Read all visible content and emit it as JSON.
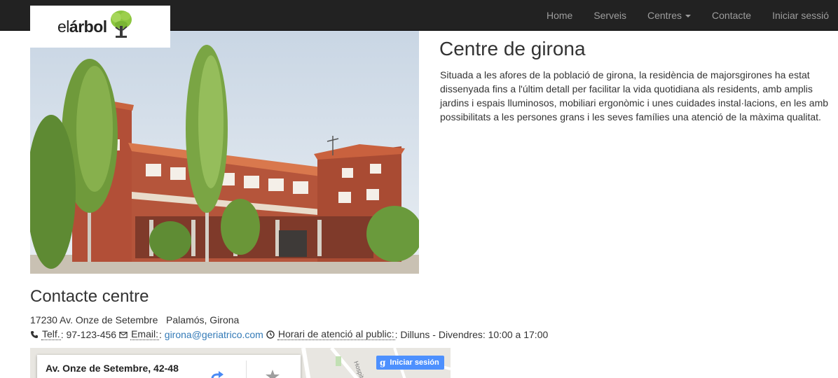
{
  "nav": {
    "items": [
      {
        "label": "Home"
      },
      {
        "label": "Serveis"
      },
      {
        "label": "Centres"
      },
      {
        "label": "Contacte"
      },
      {
        "label": "Iniciar sessió"
      }
    ]
  },
  "logo": {
    "text_light": "el",
    "text_bold": "árbol"
  },
  "centre": {
    "title": "Centre de girona",
    "description": "Situada a les afores de la població de girona, la residència de majorsgirones ha estat dissenyada fins a l'últim detall per facilitar la vida quotidiana als residents, amb amplis jardins i espais lluminosos, mobiliari ergonòmic i unes cuidades instal·lacions, en les amb possibilitats a les persones grans i les seves famílies una atenció de la màxima qualitat."
  },
  "contact": {
    "heading": "Contacte centre",
    "address": "17230 Av. Onze de Setembre   Palamós, Girona",
    "phone_label": "Telf.",
    "phone_sep": ":",
    "phone": "97-123-456",
    "email_label": "Email:",
    "email_sep": ":",
    "email": "girona@geriatrico.com",
    "hours_label": "Horari de atenció al public:",
    "hours_sep": ":",
    "hours": "Dilluns - Divendres: 10:00 a 17:00"
  },
  "map": {
    "place": "Av. Onze de Setembre, 42-48",
    "signin_label": "Iniciar sesión",
    "signin_g": "g"
  },
  "colors": {
    "navbar_bg": "#222222",
    "nav_text": "#9d9d9d",
    "link": "#337ab7",
    "google_blue": "#4d90fe",
    "tree_green": "#8cc63f"
  },
  "icons": [
    "phone-icon",
    "envelope-icon",
    "clock-icon",
    "directions-icon",
    "star-icon",
    "tree-logo-icon"
  ]
}
